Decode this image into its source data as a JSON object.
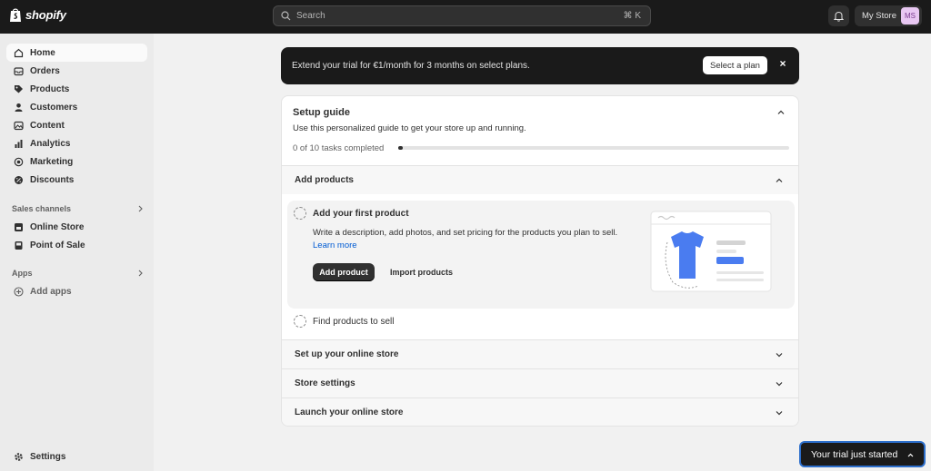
{
  "app": {
    "brand": "shopify"
  },
  "search": {
    "placeholder": "Search",
    "shortcut": "⌘ K"
  },
  "store": {
    "name": "My Store",
    "initials": "MS"
  },
  "sidebar": {
    "items": [
      {
        "label": "Home",
        "icon": "home-icon"
      },
      {
        "label": "Orders",
        "icon": "inbox-icon"
      },
      {
        "label": "Products",
        "icon": "tag-icon"
      },
      {
        "label": "Customers",
        "icon": "person-icon"
      },
      {
        "label": "Content",
        "icon": "image-icon"
      },
      {
        "label": "Analytics",
        "icon": "bar-chart-icon"
      },
      {
        "label": "Marketing",
        "icon": "target-icon"
      },
      {
        "label": "Discounts",
        "icon": "discount-icon"
      }
    ],
    "sales_channels_label": "Sales channels",
    "channels": [
      {
        "label": "Online Store",
        "icon": "store-icon"
      },
      {
        "label": "Point of Sale",
        "icon": "pos-icon"
      }
    ],
    "apps_label": "Apps",
    "add_apps": "Add apps",
    "settings": "Settings"
  },
  "banner": {
    "text": "Extend your trial for €1/month for 3 months on select plans.",
    "button": "Select a plan",
    "close": "×"
  },
  "setup": {
    "title": "Setup guide",
    "subtitle": "Use this personalized guide to get your store up and running.",
    "progress_text": "0 of 10 tasks completed",
    "progress": 0.0,
    "sections": [
      "Add products",
      "Set up your online store",
      "Store settings",
      "Launch your online store"
    ],
    "task_active": {
      "title": "Add your first product",
      "description": "Write a description, add photos, and set pricing for the products you plan to sell.",
      "link": "Learn more",
      "primary": "Add product",
      "secondary": "Import products"
    },
    "task_next": "Find products to sell"
  },
  "trial": {
    "label": "Your trial just started"
  },
  "colors": {
    "topbar": "#1a1a1a",
    "accent_link": "#005bd3",
    "shirt": "#4a7cf0",
    "avatar_bg": "#e8c7f2"
  }
}
